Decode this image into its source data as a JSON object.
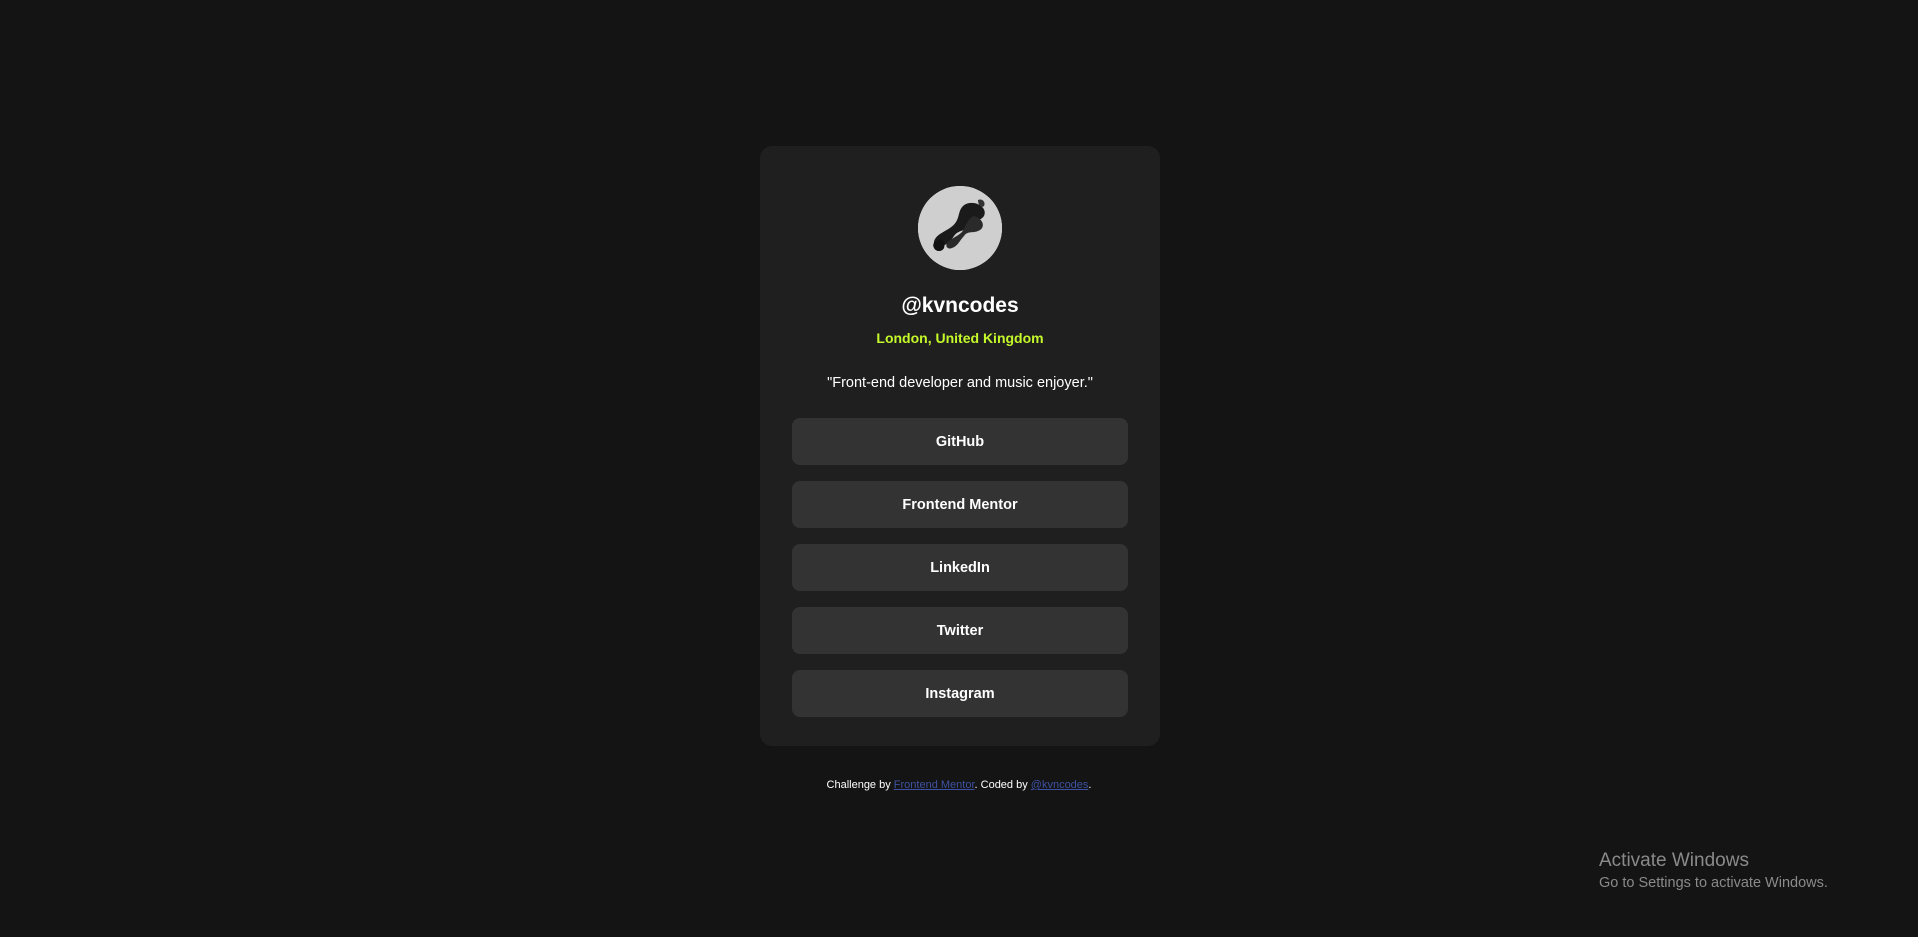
{
  "profile": {
    "avatar_alt": "avatar",
    "name": "@kvncodes",
    "location": "London, United Kingdom",
    "bio": "\"Front-end developer and music enjoyer.\""
  },
  "links": [
    {
      "label": "GitHub"
    },
    {
      "label": "Frontend Mentor"
    },
    {
      "label": "LinkedIn"
    },
    {
      "label": "Twitter"
    },
    {
      "label": "Instagram"
    }
  ],
  "footer": {
    "prefix": "Challenge by ",
    "challenge_link": "Frontend Mentor",
    "middle": ". Coded by ",
    "author_link": "@kvncodes",
    "suffix": "."
  },
  "watermark": {
    "title": "Activate Windows",
    "subtitle": "Go to Settings to activate Windows."
  },
  "colors": {
    "background": "#141414",
    "card": "#1f1f1f",
    "button": "#333333",
    "accent": "#c4f82a",
    "link": "#3e52a3"
  }
}
